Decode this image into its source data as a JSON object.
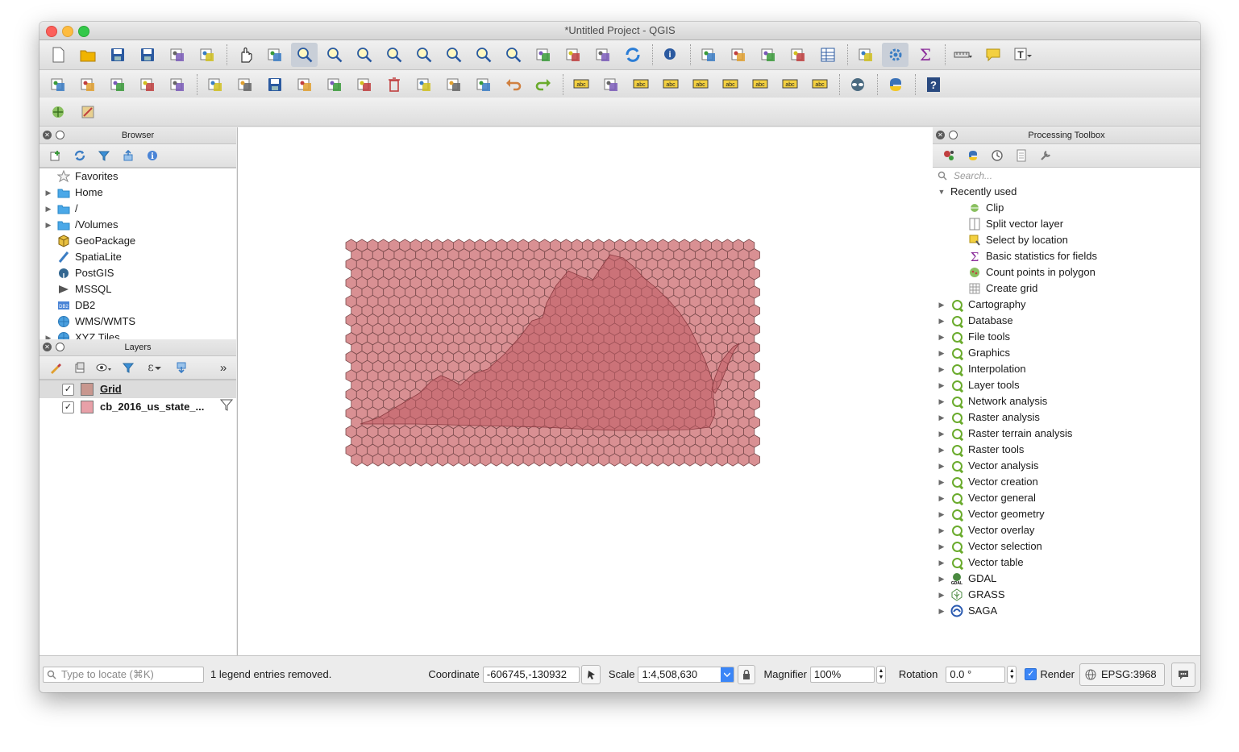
{
  "window": {
    "title": "*Untitled Project - QGIS"
  },
  "toolbar1": {
    "icons": [
      "new-project-icon",
      "open-project-icon",
      "save-project-icon",
      "save-as-icon",
      "new-print-layout-icon",
      "layout-manager-icon",
      "pan-icon",
      "pan-to-selection-icon",
      "zoom-in-icon",
      "zoom-out-icon",
      "zoom-native-icon",
      "zoom-full-icon",
      "zoom-to-selection-icon",
      "zoom-to-layer-icon",
      "zoom-last-icon",
      "zoom-next-icon",
      "new-map-view-icon",
      "new-bookmark-icon",
      "show-bookmarks-icon",
      "refresh-icon",
      "identify-icon",
      "select-feature-icon",
      "select-by-area-icon",
      "select-by-value-icon",
      "deselect-icon",
      "attribute-table-icon",
      "field-calculator-icon",
      "processing-toolbox-icon",
      "statistics-sigma-icon",
      "measure-icon",
      "map-tips-icon",
      "text-annotation-icon"
    ]
  },
  "toolbar2": {
    "icons": [
      "data-source-manager-icon",
      "new-geopackage-icon",
      "new-virtual-layer-icon",
      "new-shapefile-icon",
      "new-temporary-layer-icon",
      "current-edits-icon",
      "toggle-editing-icon",
      "save-edits-icon",
      "add-feature-icon",
      "vertex-tool-icon",
      "modify-attributes-icon",
      "delete-selected-icon",
      "cut-features-icon",
      "copy-features-icon",
      "paste-features-icon",
      "undo-icon",
      "redo-icon",
      "label-toolbar-icon",
      "layer-diagram-icon",
      "highlight-pinned-labels-icon",
      "pin-labels-icon",
      "show-hide-labels-icon",
      "move-label-icon",
      "rotate-label-icon",
      "change-label-icon",
      "change-label-props-icon",
      "globe-plugin-icon",
      "python-console-icon",
      "help-icon"
    ]
  },
  "toolbar3": {
    "icons": [
      "digitize-plugin-icon",
      "georeferencer-icon"
    ]
  },
  "browser": {
    "title": "Browser",
    "items": [
      {
        "label": "Favorites",
        "icon": "star-icon",
        "expandable": false
      },
      {
        "label": "Home",
        "icon": "folder-icon",
        "expandable": true
      },
      {
        "label": "/",
        "icon": "folder-icon",
        "expandable": true
      },
      {
        "label": "/Volumes",
        "icon": "folder-icon",
        "expandable": true
      },
      {
        "label": "GeoPackage",
        "icon": "geopackage-icon",
        "expandable": false
      },
      {
        "label": "SpatiaLite",
        "icon": "spatialite-icon",
        "expandable": false
      },
      {
        "label": "PostGIS",
        "icon": "postgis-elephant-icon",
        "expandable": false
      },
      {
        "label": "MSSQL",
        "icon": "mssql-icon",
        "expandable": false
      },
      {
        "label": "DB2",
        "icon": "db2-icon",
        "expandable": false
      },
      {
        "label": "WMS/WMTS",
        "icon": "globe-icon",
        "expandable": false
      },
      {
        "label": "XYZ Tiles",
        "icon": "globe-icon",
        "expandable": true
      }
    ]
  },
  "layers": {
    "title": "Layers",
    "items": [
      {
        "label": "Grid",
        "checked": true,
        "swatch": "#c8978f",
        "has_filter": false
      },
      {
        "label": "cb_2016_us_state_...",
        "checked": true,
        "swatch": "#e8a0a8",
        "has_filter": true
      }
    ]
  },
  "processing": {
    "title": "Processing Toolbox",
    "search_placeholder": "Search...",
    "recent_label": "Recently used",
    "recent": [
      {
        "label": "Clip",
        "icon": "clip-icon"
      },
      {
        "label": "Split vector layer",
        "icon": "split-vector-icon"
      },
      {
        "label": "Select by location",
        "icon": "select-by-location-icon"
      },
      {
        "label": "Basic statistics for fields",
        "icon": "sigma-icon"
      },
      {
        "label": "Count points in polygon",
        "icon": "count-points-icon"
      },
      {
        "label": "Create grid",
        "icon": "grid-icon"
      }
    ],
    "groups": [
      "Cartography",
      "Database",
      "File tools",
      "Graphics",
      "Interpolation",
      "Layer tools",
      "Network analysis",
      "Raster analysis",
      "Raster terrain analysis",
      "Raster tools",
      "Vector analysis",
      "Vector creation",
      "Vector general",
      "Vector geometry",
      "Vector overlay",
      "Vector selection",
      "Vector table"
    ],
    "providers": [
      {
        "label": "GDAL",
        "icon": "gdal-icon"
      },
      {
        "label": "GRASS",
        "icon": "grass-icon"
      },
      {
        "label": "SAGA",
        "icon": "saga-icon"
      }
    ]
  },
  "status": {
    "locator_placeholder": "Type to locate (⌘K)",
    "message": "1 legend entries removed.",
    "coordinate_label": "Coordinate",
    "coordinate_value": "-606745,-130932",
    "scale_label": "Scale",
    "scale_value": "1:4,508,630",
    "magnifier_label": "Magnifier",
    "magnifier_value": "100%",
    "rotation_label": "Rotation",
    "rotation_value": "0.0 °",
    "render_label": "Render",
    "crs_label": "EPSG:3968"
  },
  "map": {
    "hex_fill": "#d99093",
    "hex_stroke": "#7a4a4c",
    "state_fill": "#c05a62"
  }
}
